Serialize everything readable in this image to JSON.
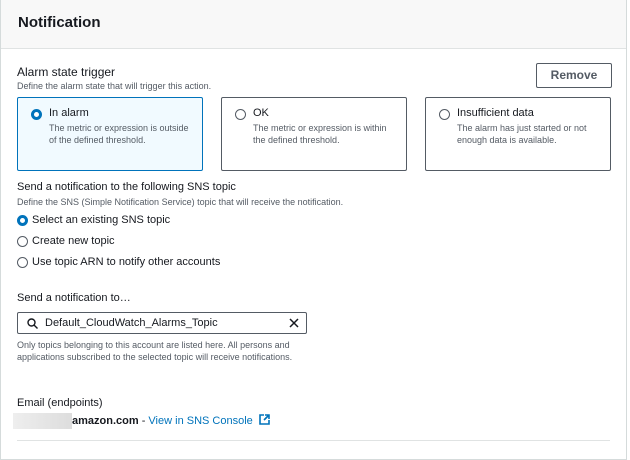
{
  "header": {
    "title": "Notification"
  },
  "trigger": {
    "label": "Alarm state trigger",
    "description": "Define the alarm state that will trigger this action.",
    "remove_label": "Remove",
    "options": [
      {
        "title": "In alarm",
        "description": "The metric or expression is outside of the defined threshold.",
        "selected": true
      },
      {
        "title": "OK",
        "description": "The metric or expression is within the defined threshold.",
        "selected": false
      },
      {
        "title": "Insufficient data",
        "description": "The alarm has just started or not enough data is available.",
        "selected": false
      }
    ]
  },
  "sns": {
    "label": "Send a notification to the following SNS topic",
    "description": "Define the SNS (Simple Notification Service) topic that will receive the notification.",
    "options": [
      "Select an existing SNS topic",
      "Create new topic",
      "Use topic ARN to notify other accounts"
    ]
  },
  "send_to": {
    "label": "Send a notification to…",
    "value": "Default_CloudWatch_Alarms_Topic",
    "hint": "Only topics belonging to this account are listed here. All persons and applications subscribed to the selected topic will receive notifications."
  },
  "email": {
    "label": "Email (endpoints)",
    "domain": "amazon.com",
    "separator": " - ",
    "link": "View in SNS Console"
  },
  "colors": {
    "accent": "#0073bb"
  }
}
